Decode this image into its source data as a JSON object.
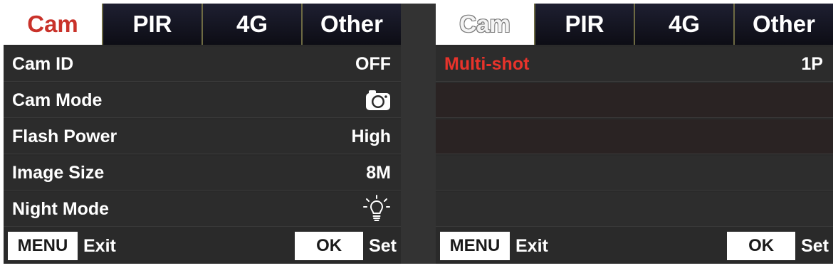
{
  "left_screen": {
    "tabs": [
      {
        "label": "Cam"
      },
      {
        "label": "PIR"
      },
      {
        "label": "4G"
      },
      {
        "label": "Other"
      }
    ],
    "rows": [
      {
        "label": "Cam ID",
        "value": "OFF"
      },
      {
        "label": "Cam Mode",
        "icon": "camera-icon"
      },
      {
        "label": "Flash Power",
        "value": "High"
      },
      {
        "label": "Image Size",
        "value": "8M"
      },
      {
        "label": "Night Mode",
        "icon": "light-bulb-icon"
      }
    ],
    "footer": {
      "menu_key": "MENU",
      "menu_action": "Exit",
      "ok_key": "OK",
      "ok_action": "Set"
    }
  },
  "right_screen": {
    "tabs": [
      {
        "label": "Cam"
      },
      {
        "label": "PIR"
      },
      {
        "label": "4G"
      },
      {
        "label": "Other"
      }
    ],
    "rows": [
      {
        "label": "Multi-shot",
        "value": "1P"
      }
    ],
    "footer": {
      "menu_key": "MENU",
      "menu_action": "Exit",
      "ok_key": "OK",
      "ok_action": "Set"
    }
  },
  "colors": {
    "active_tab_text": "#c9322a",
    "selected_row_text": "#e8332b",
    "screen_background": "#2a2a2a",
    "tab_background": "#14151f"
  }
}
